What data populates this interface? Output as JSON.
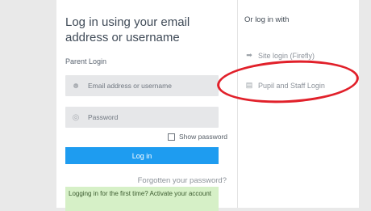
{
  "login": {
    "title": "Log in using your email address or username",
    "section_label": "Parent Login",
    "email_placeholder": "Email address or username",
    "password_placeholder": "Password",
    "show_password_label": "Show password",
    "login_button": "Log in",
    "forgot_link": "Forgotten your password?",
    "first_time_notice": "Logging in for the first time? Activate your account"
  },
  "sso": {
    "heading": "Or log in with",
    "providers": [
      {
        "label": "Site login (Firefly)",
        "icon": "sign-in-icon"
      },
      {
        "label": "Pupil and Staff Login",
        "icon": "book-icon"
      }
    ]
  },
  "annotation": {
    "color": "#e1202a",
    "target": "Pupil and Staff Login"
  },
  "colors": {
    "primary_button": "#1e9cf0",
    "notice_background": "#d6f0c7",
    "field_background": "#e6e7e9"
  }
}
